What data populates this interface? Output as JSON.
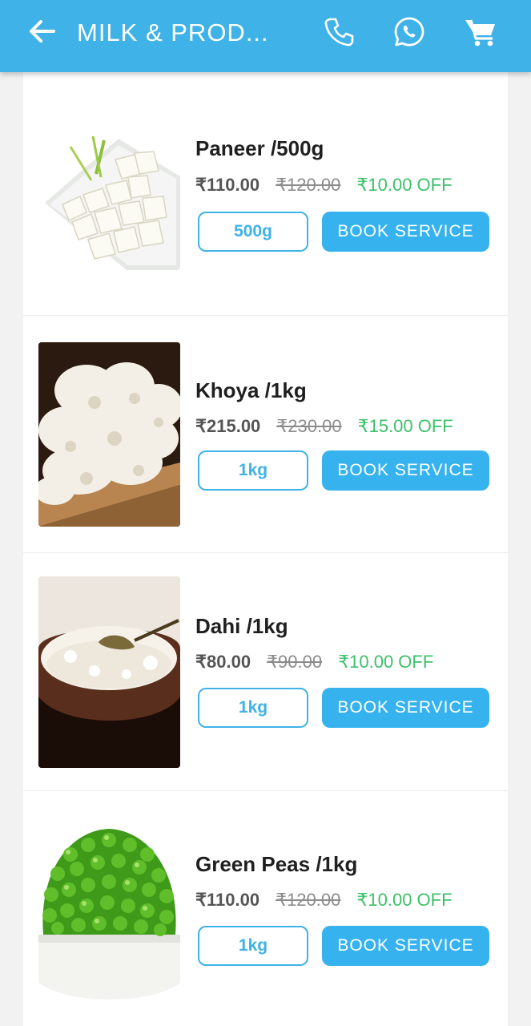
{
  "header": {
    "title": "MILK & PROD...",
    "back_icon": "arrow-left-icon",
    "call_icon": "phone-icon",
    "whatsapp_icon": "whatsapp-icon",
    "cart_icon": "cart-icon",
    "bg_color": "#3fb2e8"
  },
  "products": [
    {
      "name": "Paneer /500g",
      "price": "₹110.00",
      "mrp": "₹120.00",
      "off": "₹10.00 OFF",
      "variant": "500g",
      "button": "BOOK SERVICE"
    },
    {
      "name": "Khoya /1kg",
      "price": "₹215.00",
      "mrp": "₹230.00",
      "off": "₹15.00 OFF",
      "variant": "1kg",
      "button": "BOOK SERVICE"
    },
    {
      "name": "Dahi /1kg",
      "price": "₹80.00",
      "mrp": "₹90.00",
      "off": "₹10.00 OFF",
      "variant": "1kg",
      "button": "BOOK SERVICE"
    },
    {
      "name": "Green Peas /1kg",
      "price": "₹110.00",
      "mrp": "₹120.00",
      "off": "₹10.00 OFF",
      "variant": "1kg",
      "button": "BOOK SERVICE"
    }
  ],
  "colors": {
    "accent": "#36b3ee",
    "discount": "#3cc06a",
    "strike": "#8c8c8c"
  }
}
